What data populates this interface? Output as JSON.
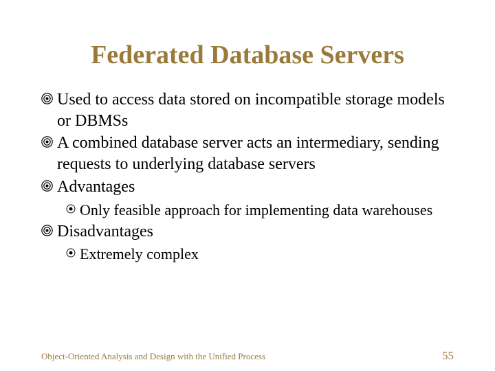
{
  "title": "Federated Database Servers",
  "bullets": [
    {
      "text": "Used to access data stored on incompatible storage models or DBMSs"
    },
    {
      "text": "A combined database server acts an intermediary, sending requests to underlying database servers"
    },
    {
      "text": "Advantages"
    }
  ],
  "sub_bullets_a": [
    {
      "text": "Only feasible approach for implementing data warehouses"
    }
  ],
  "bullets2": [
    {
      "text": "Disadvantages"
    }
  ],
  "sub_bullets_b": [
    {
      "text": "Extremely complex"
    }
  ],
  "footer": {
    "left": "Object-Oriented Analysis and Design with the Unified Process",
    "right": "55"
  },
  "colors": {
    "accent": "#9a7a3a"
  }
}
